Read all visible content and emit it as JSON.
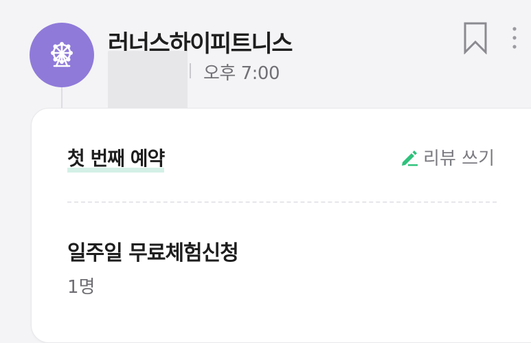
{
  "header": {
    "store_name": "러너스하이피트니스",
    "time": "오후 7:00",
    "avatar_icon": "ferris-wheel-icon",
    "bookmark_icon": "bookmark-icon",
    "more_icon": "more-vertical-icon",
    "avatar_color": "#8f7ad9"
  },
  "card": {
    "reservation_title": "첫 번째 예약",
    "review_label": "리뷰 쓰기",
    "review_icon": "pencil-icon",
    "item_name": "일주일 무료체험신청",
    "item_quantity": "1명",
    "highlight_color": "#d4f0e6",
    "accent_color": "#2fc27c"
  }
}
